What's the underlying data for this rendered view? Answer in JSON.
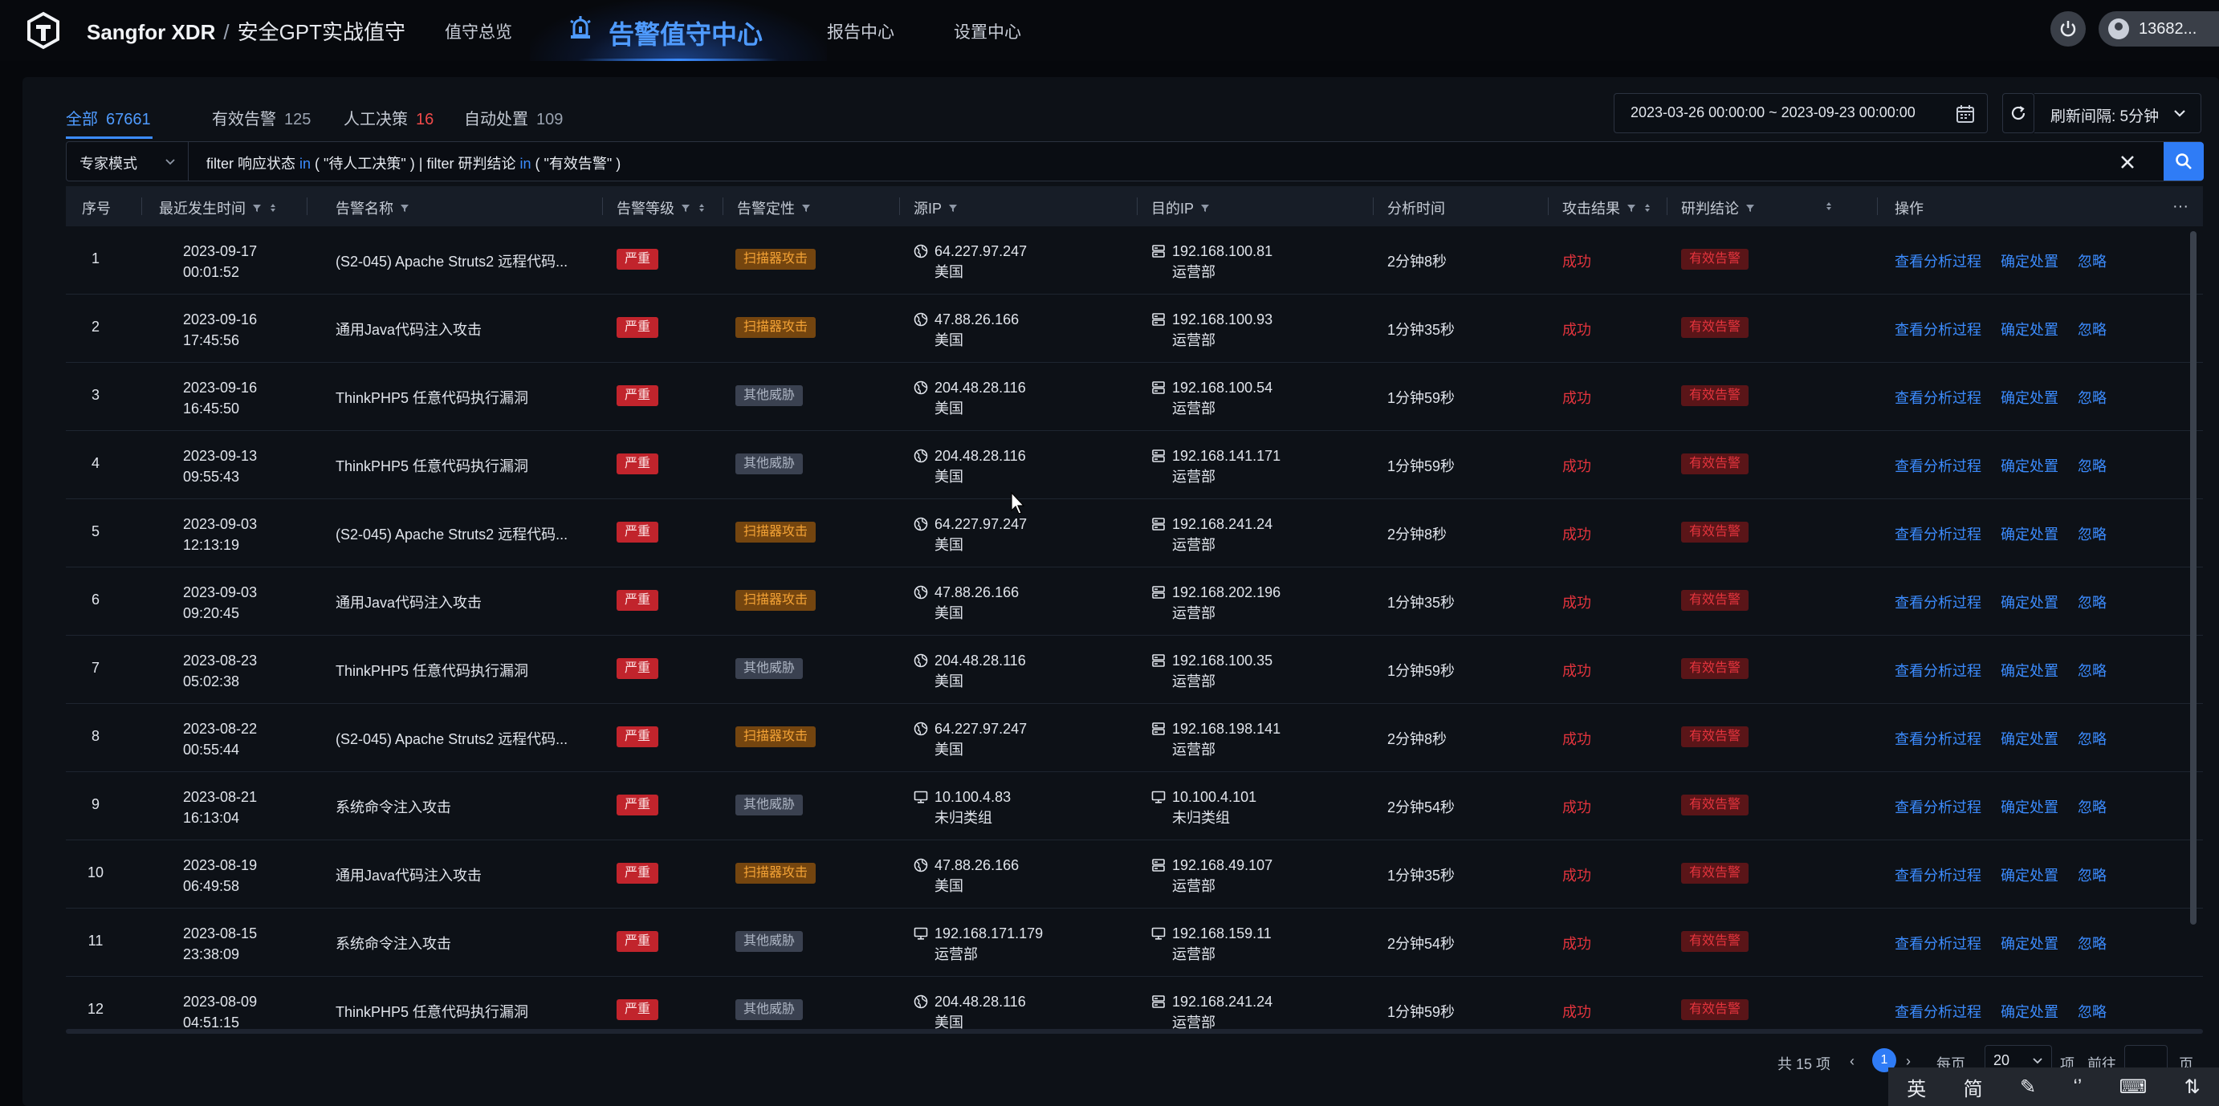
{
  "header": {
    "brand": "Sangfor XDR",
    "separator": "/",
    "subtitle": "安全GPT实战值守",
    "nav": [
      "值守总览",
      "告警值守中心",
      "报告中心",
      "设置中心"
    ],
    "active_nav": "告警值守中心",
    "user_name": "13682..."
  },
  "tabs": [
    {
      "label": "全部",
      "count": "67661"
    },
    {
      "label": "有效告警",
      "count": "125"
    },
    {
      "label": "人工决策",
      "count": "16"
    },
    {
      "label": "自动处置",
      "count": "109"
    }
  ],
  "toolbar": {
    "date_range": "2023-03-26 00:00:00 ~ 2023-09-23 00:00:00",
    "refresh_label": "刷新间隔: 5分钟"
  },
  "search": {
    "mode": "专家模式",
    "query_a": "filter 响应状态 ",
    "query_in1": "in",
    "query_b": " ( \"待人工决策\" ) | filter 研判结论 ",
    "query_in2": "in",
    "query_c": " ( \"有效告警\" )"
  },
  "table": {
    "columns": [
      "序号",
      "最近发生时间",
      "告警名称",
      "告警等级",
      "告警定性",
      "源IP",
      "目的IP",
      "分析时间",
      "攻击结果",
      "研判结论",
      "操作"
    ],
    "more": "···",
    "rows": [
      {
        "idx": "1",
        "date": "2023-09-17",
        "time": "00:01:52",
        "name": "(S2-045) Apache Struts2 远程代码...",
        "severity": "严重",
        "type": "扫描器攻击",
        "type_kind": "scan",
        "src_ip": "64.227.97.247",
        "src_loc": "美国",
        "src_kind": "globe",
        "dst_ip": "192.168.100.81",
        "dst_loc": "运营部",
        "dst_kind": "server",
        "duration": "2分钟8秒",
        "result": "成功",
        "conclusion": "有效告警"
      },
      {
        "idx": "2",
        "date": "2023-09-16",
        "time": "17:45:56",
        "name": "通用Java代码注入攻击",
        "severity": "严重",
        "type": "扫描器攻击",
        "type_kind": "scan",
        "src_ip": "47.88.26.166",
        "src_loc": "美国",
        "src_kind": "globe",
        "dst_ip": "192.168.100.93",
        "dst_loc": "运营部",
        "dst_kind": "server",
        "duration": "1分钟35秒",
        "result": "成功",
        "conclusion": "有效告警"
      },
      {
        "idx": "3",
        "date": "2023-09-16",
        "time": "16:45:50",
        "name": "ThinkPHP5 任意代码执行漏洞",
        "severity": "严重",
        "type": "其他威胁",
        "type_kind": "other",
        "src_ip": "204.48.28.116",
        "src_loc": "美国",
        "src_kind": "globe",
        "dst_ip": "192.168.100.54",
        "dst_loc": "运营部",
        "dst_kind": "server",
        "duration": "1分钟59秒",
        "result": "成功",
        "conclusion": "有效告警"
      },
      {
        "idx": "4",
        "date": "2023-09-13",
        "time": "09:55:43",
        "name": "ThinkPHP5 任意代码执行漏洞",
        "severity": "严重",
        "type": "其他威胁",
        "type_kind": "other",
        "src_ip": "204.48.28.116",
        "src_loc": "美国",
        "src_kind": "globe",
        "dst_ip": "192.168.141.171",
        "dst_loc": "运营部",
        "dst_kind": "server",
        "duration": "1分钟59秒",
        "result": "成功",
        "conclusion": "有效告警"
      },
      {
        "idx": "5",
        "date": "2023-09-03",
        "time": "12:13:19",
        "name": "(S2-045) Apache Struts2 远程代码...",
        "severity": "严重",
        "type": "扫描器攻击",
        "type_kind": "scan",
        "src_ip": "64.227.97.247",
        "src_loc": "美国",
        "src_kind": "globe",
        "dst_ip": "192.168.241.24",
        "dst_loc": "运营部",
        "dst_kind": "server",
        "duration": "2分钟8秒",
        "result": "成功",
        "conclusion": "有效告警"
      },
      {
        "idx": "6",
        "date": "2023-09-03",
        "time": "09:20:45",
        "name": "通用Java代码注入攻击",
        "severity": "严重",
        "type": "扫描器攻击",
        "type_kind": "scan",
        "src_ip": "47.88.26.166",
        "src_loc": "美国",
        "src_kind": "globe",
        "dst_ip": "192.168.202.196",
        "dst_loc": "运营部",
        "dst_kind": "server",
        "duration": "1分钟35秒",
        "result": "成功",
        "conclusion": "有效告警"
      },
      {
        "idx": "7",
        "date": "2023-08-23",
        "time": "05:02:38",
        "name": "ThinkPHP5 任意代码执行漏洞",
        "severity": "严重",
        "type": "其他威胁",
        "type_kind": "other",
        "src_ip": "204.48.28.116",
        "src_loc": "美国",
        "src_kind": "globe",
        "dst_ip": "192.168.100.35",
        "dst_loc": "运营部",
        "dst_kind": "server",
        "duration": "1分钟59秒",
        "result": "成功",
        "conclusion": "有效告警"
      },
      {
        "idx": "8",
        "date": "2023-08-22",
        "time": "00:55:44",
        "name": "(S2-045) Apache Struts2 远程代码...",
        "severity": "严重",
        "type": "扫描器攻击",
        "type_kind": "scan",
        "src_ip": "64.227.97.247",
        "src_loc": "美国",
        "src_kind": "globe",
        "dst_ip": "192.168.198.141",
        "dst_loc": "运营部",
        "dst_kind": "server",
        "duration": "2分钟8秒",
        "result": "成功",
        "conclusion": "有效告警"
      },
      {
        "idx": "9",
        "date": "2023-08-21",
        "time": "16:13:04",
        "name": "系统命令注入攻击",
        "severity": "严重",
        "type": "其他威胁",
        "type_kind": "other",
        "src_ip": "10.100.4.83",
        "src_loc": "未归类组",
        "src_kind": "monitor",
        "dst_ip": "10.100.4.101",
        "dst_loc": "未归类组",
        "dst_kind": "monitor",
        "duration": "2分钟54秒",
        "result": "成功",
        "conclusion": "有效告警"
      },
      {
        "idx": "10",
        "date": "2023-08-19",
        "time": "06:49:58",
        "name": "通用Java代码注入攻击",
        "severity": "严重",
        "type": "扫描器攻击",
        "type_kind": "scan",
        "src_ip": "47.88.26.166",
        "src_loc": "美国",
        "src_kind": "globe",
        "dst_ip": "192.168.49.107",
        "dst_loc": "运营部",
        "dst_kind": "server",
        "duration": "1分钟35秒",
        "result": "成功",
        "conclusion": "有效告警"
      },
      {
        "idx": "11",
        "date": "2023-08-15",
        "time": "23:38:09",
        "name": "系统命令注入攻击",
        "severity": "严重",
        "type": "其他威胁",
        "type_kind": "other",
        "src_ip": "192.168.171.179",
        "src_loc": "运营部",
        "src_kind": "monitor",
        "dst_ip": "192.168.159.11",
        "dst_loc": "运营部",
        "dst_kind": "monitor",
        "duration": "2分钟54秒",
        "result": "成功",
        "conclusion": "有效告警"
      },
      {
        "idx": "12",
        "date": "2023-08-09",
        "time": "04:51:15",
        "name": "ThinkPHP5 任意代码执行漏洞",
        "severity": "严重",
        "type": "其他威胁",
        "type_kind": "other",
        "src_ip": "204.48.28.116",
        "src_loc": "美国",
        "src_kind": "globe",
        "dst_ip": "192.168.241.24",
        "dst_loc": "运营部",
        "dst_kind": "server",
        "duration": "1分钟59秒",
        "result": "成功",
        "conclusion": "有效告警"
      }
    ],
    "actions": [
      "查看分析过程",
      "确定处置",
      "忽略"
    ]
  },
  "pagination": {
    "total": "共 15 项",
    "prev": "‹",
    "current": "1",
    "next": "›",
    "per_page_label": "每页",
    "per_page": "20",
    "per_page_unit": "项",
    "goto_label": "前往",
    "goto_unit": "页"
  },
  "ime": [
    "英",
    "简",
    "✎",
    "‘’",
    "⌨",
    "⇅"
  ],
  "colors": {
    "accent": "#3c8cff",
    "severity_bg": "#c1242c",
    "scan_bg": "#74450f",
    "scan_text": "#f3a235",
    "result_red": "#e4343d"
  }
}
